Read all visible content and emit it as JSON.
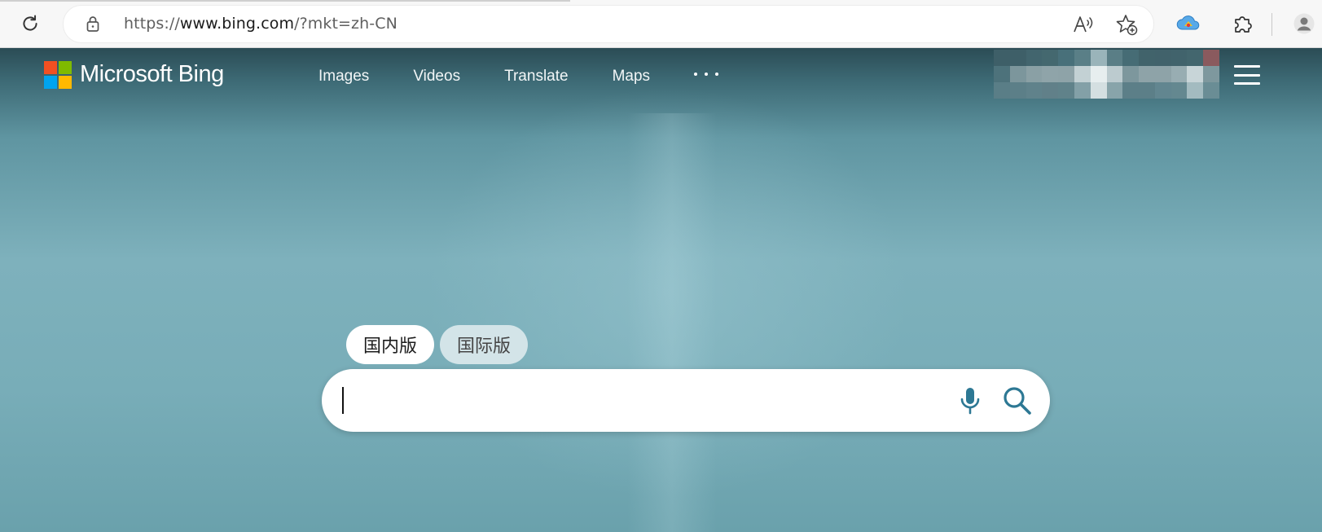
{
  "browser": {
    "url_prefix": "https://",
    "url_host": "www.bing.com",
    "url_path": "/?mkt=zh-CN",
    "icons": {
      "reload": "reload-icon",
      "lock": "lock-icon",
      "read_aloud": "read-aloud-icon",
      "add_favorite": "add-favorite-icon",
      "extension_cloud": "cloud-extension-icon",
      "extensions": "puzzle-piece-icon",
      "profile": "profile-icon"
    }
  },
  "header": {
    "brand": "Microsoft Bing",
    "logo_colors": [
      "#f25022",
      "#7fba00",
      "#00a4ef",
      "#ffb900"
    ],
    "nav": [
      {
        "label": "Images"
      },
      {
        "label": "Videos"
      },
      {
        "label": "Translate"
      },
      {
        "label": "Maps"
      }
    ],
    "more_icon": "more-dots-icon",
    "menu_icon": "hamburger-menu-icon"
  },
  "search": {
    "version_tabs": [
      {
        "label": "国内版",
        "active": true
      },
      {
        "label": "国际版",
        "active": false
      }
    ],
    "query": "",
    "mic_icon": "microphone-icon",
    "search_icon": "search-icon",
    "accent_color": "#2d7894"
  }
}
